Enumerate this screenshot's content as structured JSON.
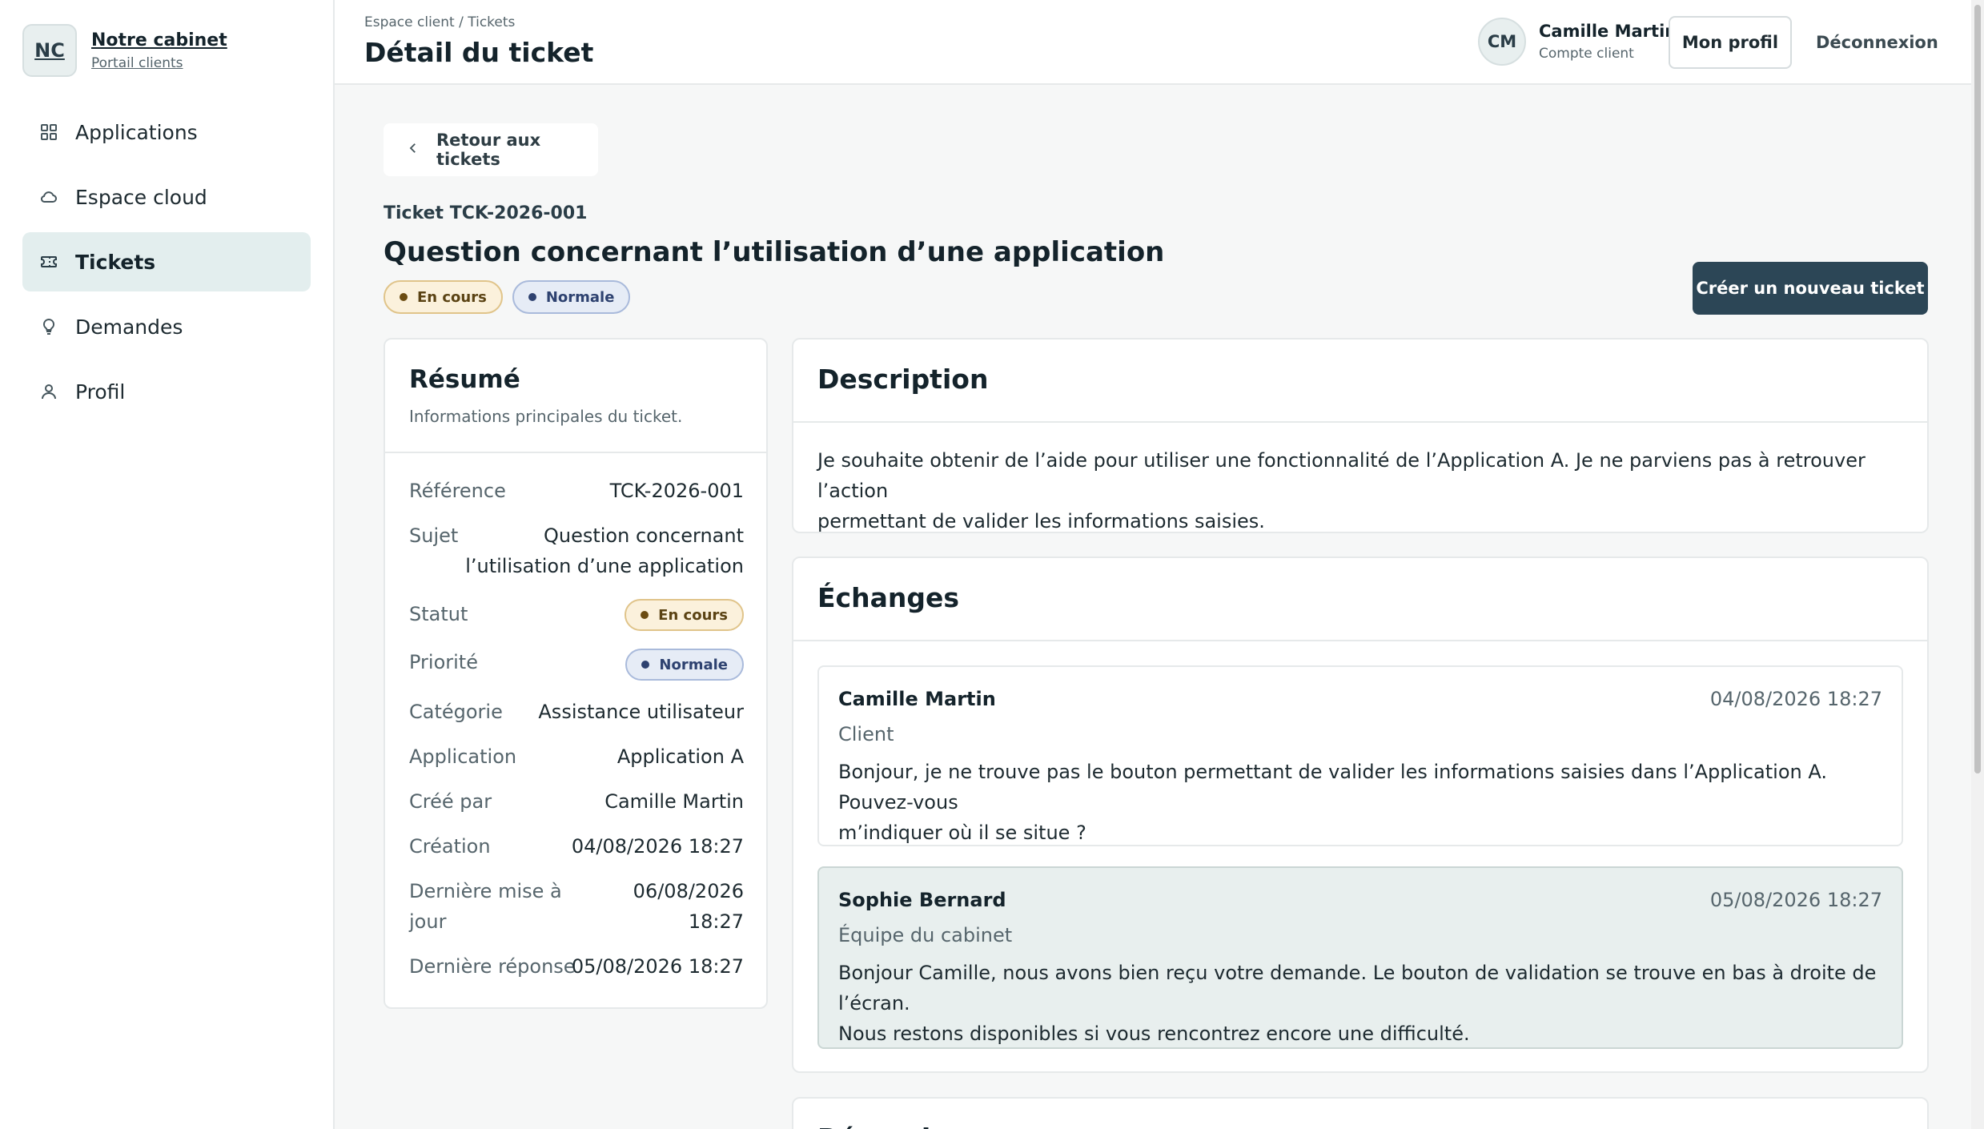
{
  "brand": {
    "initials": "NC",
    "name": "Notre cabinet",
    "subtitle": "Portail clients"
  },
  "nav": {
    "items": [
      {
        "label": "Applications",
        "icon": "grid-icon",
        "active": false
      },
      {
        "label": "Espace cloud",
        "icon": "cloud-icon",
        "active": false
      },
      {
        "label": "Tickets",
        "icon": "ticket-icon",
        "active": true
      },
      {
        "label": "Demandes",
        "icon": "lightbulb-icon",
        "active": false
      },
      {
        "label": "Profil",
        "icon": "user-icon",
        "active": false
      }
    ]
  },
  "header": {
    "breadcrumb": "Espace client / Tickets",
    "title": "Détail du ticket",
    "user": {
      "initials": "CM",
      "name": "Camille Martin",
      "role": "Compte client"
    },
    "profile_label": "Mon profil",
    "logout_label": "Déconnexion"
  },
  "ticket": {
    "back_label": "Retour aux tickets",
    "ref_label": "Ticket TCK-2026-001",
    "title": "Question concernant l’utilisation d’une application",
    "status": "En cours",
    "priority": "Normale",
    "create_label": "Créer un nouveau ticket"
  },
  "summary": {
    "title": "Résumé",
    "subtitle": "Informations principales du ticket.",
    "rows": {
      "reference": {
        "k": "Référence",
        "v": "TCK-2026-001"
      },
      "sujet": {
        "k": "Sujet",
        "v1": "Question concernant",
        "v2": "l’utilisation d’une application"
      },
      "statut": {
        "k": "Statut",
        "v": "En cours"
      },
      "priorite": {
        "k": "Priorité",
        "v": "Normale"
      },
      "categorie": {
        "k": "Catégorie",
        "v": "Assistance utilisateur"
      },
      "application": {
        "k": "Application",
        "v": "Application A"
      },
      "cree_par": {
        "k": "Créé par",
        "v": "Camille Martin"
      },
      "creation": {
        "k": "Création",
        "v": "04/08/2026 18:27"
      },
      "maj": {
        "k1": "Dernière mise à",
        "k2": "jour",
        "v1": "06/08/2026",
        "v2": "18:27"
      },
      "reponse": {
        "k": "Dernière réponse",
        "v": "05/08/2026 18:27"
      }
    }
  },
  "description": {
    "title": "Description",
    "line1": "Je souhaite obtenir de l’aide pour utiliser une fonctionnalité de l’Application A. Je ne parviens pas à retrouver l’action",
    "line2": "permettant de valider les informations saisies."
  },
  "exchanges": {
    "title": "Échanges",
    "messages": [
      {
        "author": "Camille Martin",
        "date": "04/08/2026 18:27",
        "role": "Client",
        "line1": "Bonjour, je ne trouve pas le bouton permettant de valider les informations saisies dans l’Application A. Pouvez-vous",
        "line2": "m’indiquer où il se situe ?"
      },
      {
        "author": "Sophie Bernard",
        "date": "05/08/2026 18:27",
        "role": "Équipe du cabinet",
        "line1": "Bonjour Camille, nous avons bien reçu votre demande. Le bouton de validation se trouve en bas à droite de l’écran.",
        "line2": "Nous restons disponibles si vous rencontrez encore une difficulté."
      }
    ]
  },
  "reply": {
    "title": "Répondre"
  },
  "colors": {
    "accent": "#2c4656",
    "active_nav_bg": "#e3eeee",
    "status_bg": "#fbf1dc",
    "priority_bg": "#e6ecf6"
  }
}
